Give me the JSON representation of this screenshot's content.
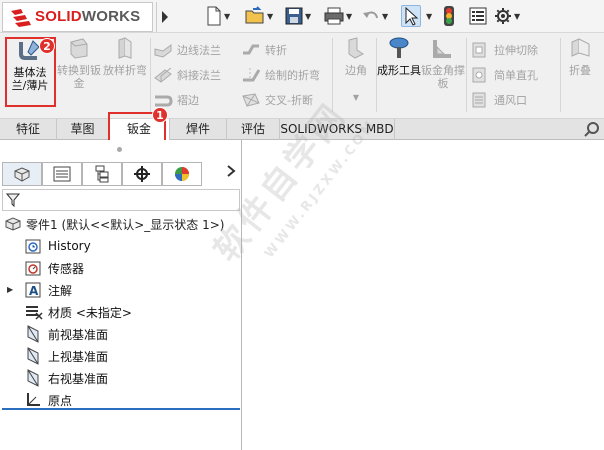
{
  "app": {
    "logo_prefix": "S",
    "logo_brand_a": "SOLID",
    "logo_brand_b": "WORKS"
  },
  "quick_toolbar": {
    "icons": [
      "new-document-icon",
      "open-folder-icon",
      "save-icon",
      "print-icon",
      "undo-icon",
      "select-cursor-icon",
      "traffic-light-icon",
      "file-properties-icon",
      "options-gear-icon"
    ]
  },
  "ribbon": {
    "base_flange": "基体法兰/薄片",
    "convert_to_sheet": "转换到钣金",
    "lofted_bend": "放样折弯",
    "edge_flange": "边线法兰",
    "miter_flange": "斜接法兰",
    "hem": "褶边",
    "jog": "转折",
    "sketched_bend": "绘制的折弯",
    "cross_break": "交叉-折断",
    "corners": "边角",
    "forming_tool": "成形工具",
    "gusset": "钣金角撑板",
    "extruded_cut": "拉伸切除",
    "simple_hole": "简单直孔",
    "vent": "通风口",
    "unfold": "折叠",
    "annotation_badge_2": "2"
  },
  "command_tabs": {
    "items": [
      "特征",
      "草图",
      "钣金",
      "焊件",
      "评估",
      "SOLIDWORKS MBD"
    ],
    "selected": "钣金",
    "annotation_badge_1": "1"
  },
  "feature_tree": {
    "root_label": "零件1  (默认<<默认>_显示状态 1>)",
    "items": [
      {
        "label": "History",
        "icon": "history-icon"
      },
      {
        "label": "传感器",
        "icon": "sensor-icon"
      },
      {
        "label": "注解",
        "icon": "annotations-icon"
      },
      {
        "label": "材质 <未指定>",
        "icon": "material-icon"
      },
      {
        "label": "前视基准面",
        "icon": "plane-icon"
      },
      {
        "label": "上视基准面",
        "icon": "plane-icon"
      },
      {
        "label": "右视基准面",
        "icon": "plane-icon"
      },
      {
        "label": "原点",
        "icon": "origin-icon"
      }
    ]
  },
  "watermark": {
    "line1": "软件自学网",
    "line2": "WWW.RJZXW.COM"
  },
  "colors": {
    "brand_red": "#d91e1e",
    "annotation_red": "#e0302c",
    "selection_blue": "#2a6fbf"
  }
}
